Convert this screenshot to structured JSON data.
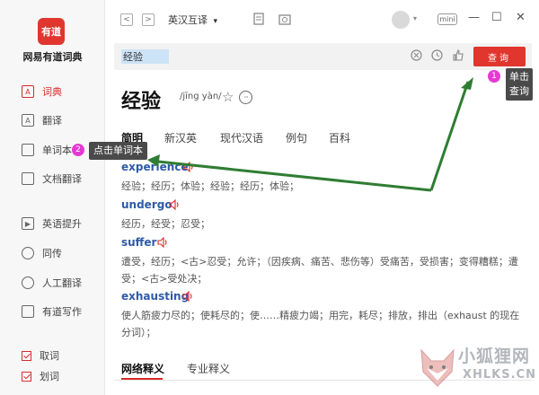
{
  "sidebar": {
    "logo_text": "有道",
    "app_name": "网易有道词典",
    "items": [
      {
        "label": "词典",
        "icon": "dictionary-icon",
        "glyph": "A"
      },
      {
        "label": "翻译",
        "icon": "translate-icon",
        "glyph": "A"
      },
      {
        "label": "单词本",
        "icon": "wordbook-icon",
        "glyph": ""
      },
      {
        "label": "文档翻译",
        "icon": "document-translate-icon",
        "glyph": ""
      },
      {
        "label": "英语提升",
        "icon": "english-improve-icon",
        "glyph": "▶"
      },
      {
        "label": "同传",
        "icon": "simultaneous-interpret-icon",
        "glyph": ""
      },
      {
        "label": "人工翻译",
        "icon": "human-translate-icon",
        "glyph": ""
      },
      {
        "label": "有道写作",
        "icon": "writing-icon",
        "glyph": ""
      }
    ],
    "checks": [
      {
        "label": "取词",
        "checked": true
      },
      {
        "label": "划词",
        "checked": true
      }
    ]
  },
  "topbar": {
    "back": "<",
    "forward": ">",
    "mode": "英汉互译",
    "mode_caret": "▾",
    "mini": "mini",
    "minimize": "—",
    "maximize": "☐",
    "close": "✕"
  },
  "search": {
    "value": "经验",
    "query_label": "查询"
  },
  "word": {
    "headword": "经验",
    "pinyin": "/jīng yàn/",
    "star": "☆",
    "more": "···"
  },
  "tabs": [
    "简明",
    "新汉英",
    "现代汉语",
    "例句",
    "百科"
  ],
  "entries": [
    {
      "word": "experience",
      "def": "经验；经历；体验；经验；经历；体验；"
    },
    {
      "word": "undergo",
      "def": "经历，经受；忍受；"
    },
    {
      "word": "suffer",
      "def": "遭受，经历；<古>忍受；允许；（因疾病、痛苦、悲伤等）受痛苦，受损害；变得糟糕；遭受；<古>受处决；"
    },
    {
      "word": "exhausting",
      "def": "使人筋疲力尽的；使耗尽的；使……精疲力竭；用完，耗尽；排放，排出（exhaust 的现在分词）；"
    }
  ],
  "bottom_tabs": [
    "网络释义",
    "专业释义"
  ],
  "annotations": {
    "badge1": "1",
    "badge2": "2",
    "tip_query": "单击查询",
    "tip_wordbook": "点击单词本",
    "arrow_color": "#2e7d32"
  },
  "watermark": {
    "title": "小狐狸网",
    "url": "XHLKS.CN"
  },
  "colors": {
    "accent": "#e0362e",
    "link": "#2e5aa7",
    "badge": "#e43ad3"
  }
}
